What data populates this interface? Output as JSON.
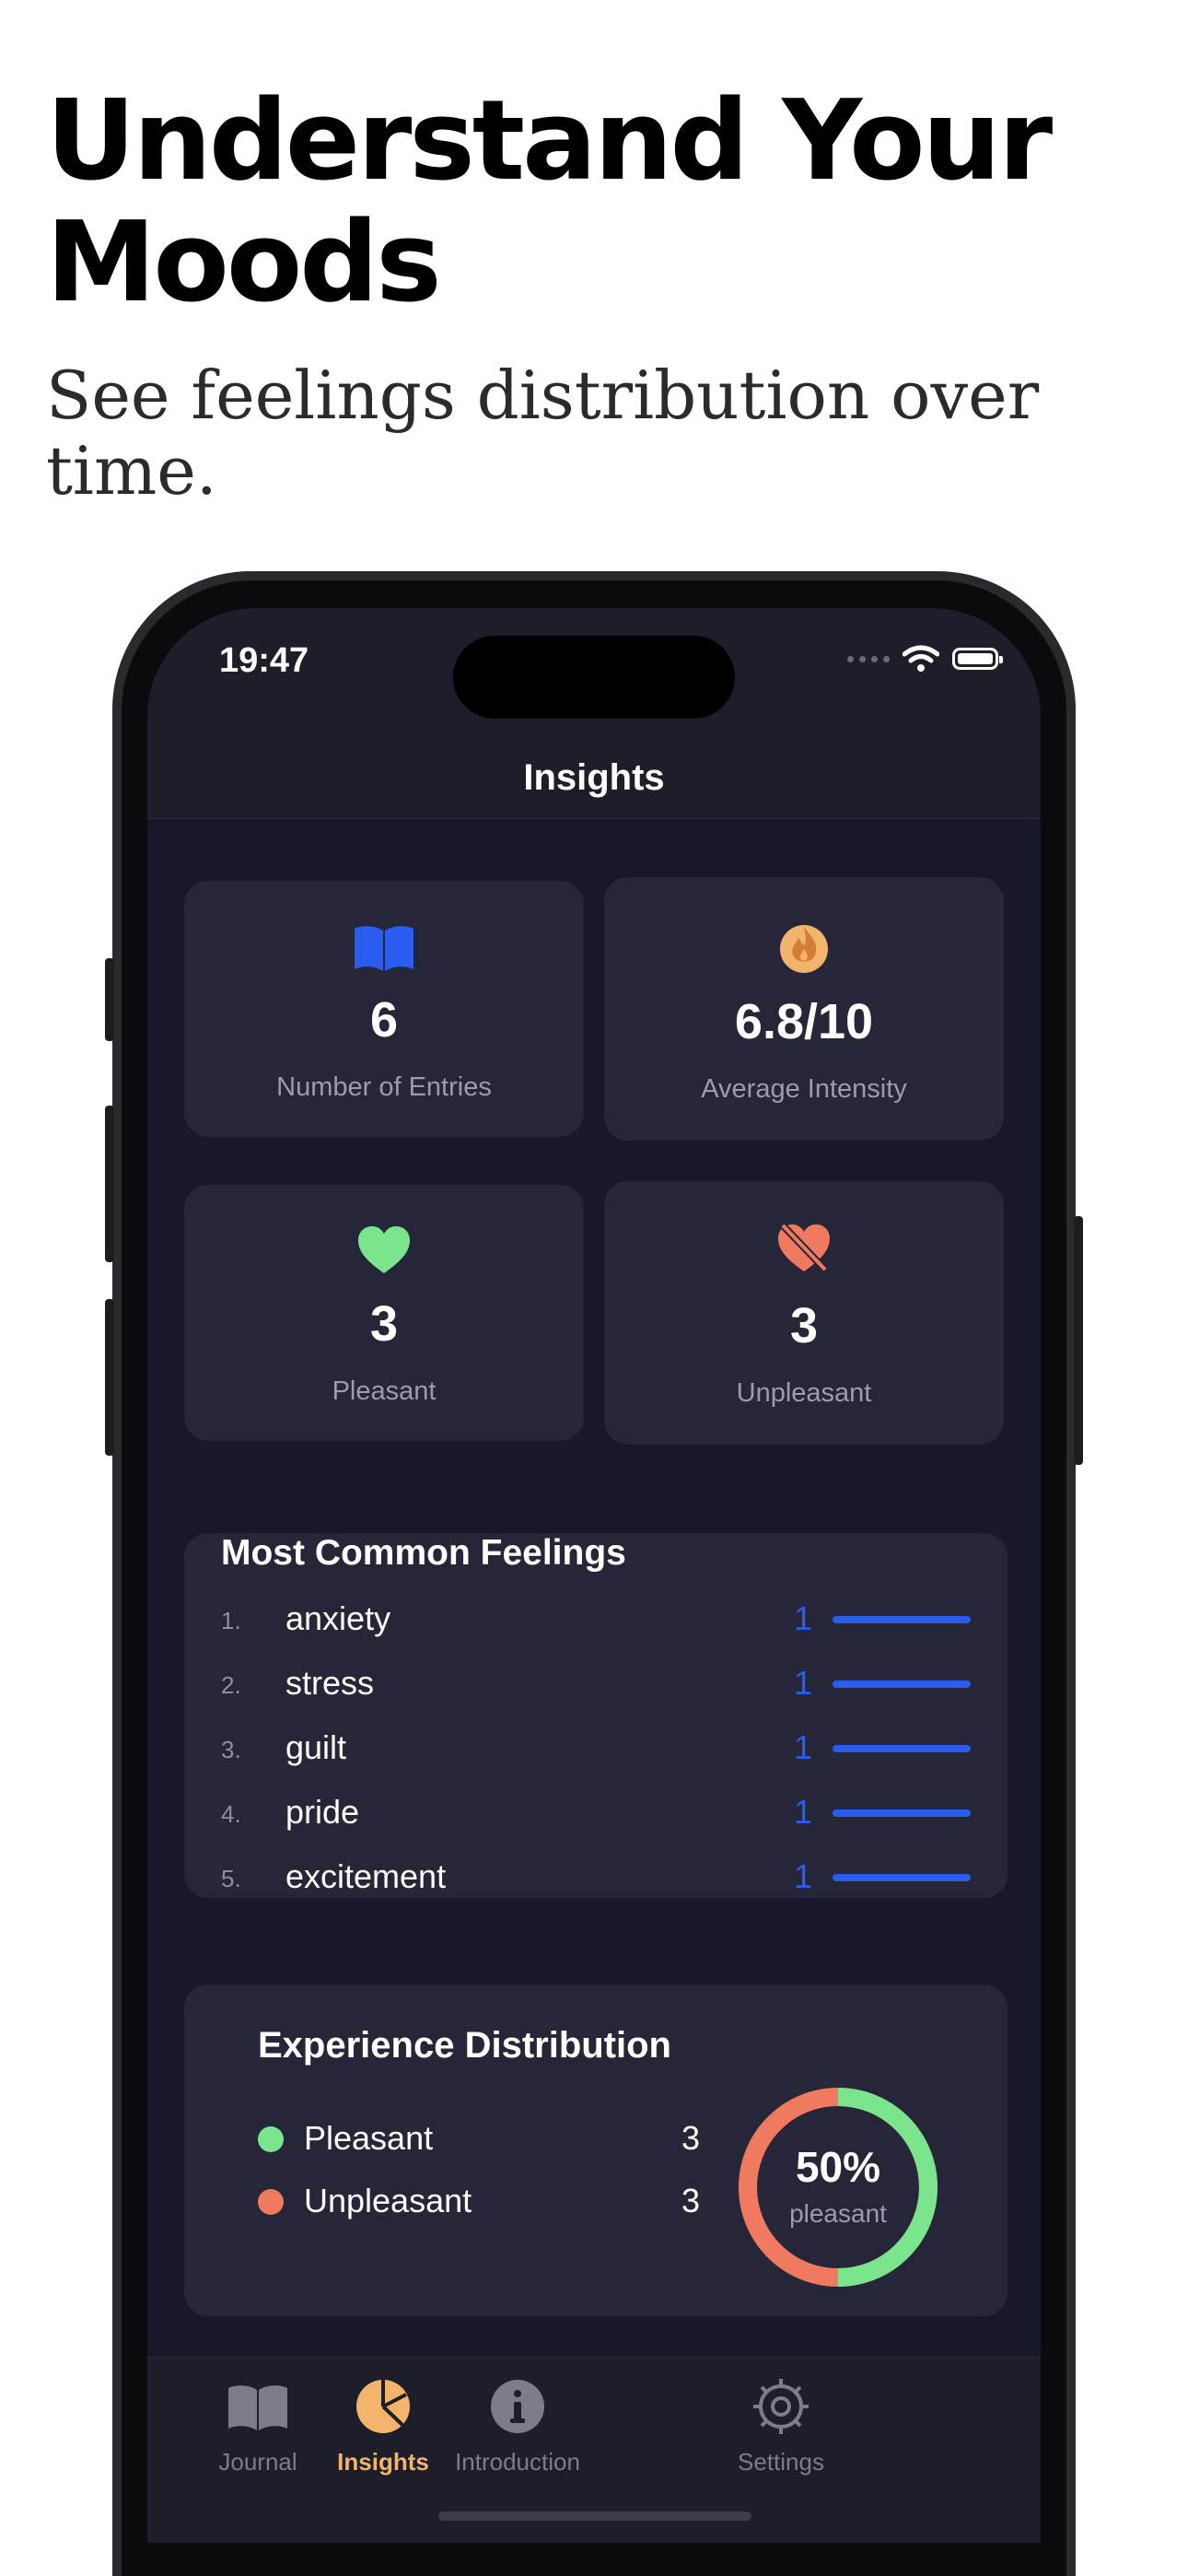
{
  "promo": {
    "headline_line1": "Understand Your",
    "headline_line2": "Moods",
    "subtitle_line1": "See feelings distribution over",
    "subtitle_line2": "time."
  },
  "status_bar": {
    "time": "19:47"
  },
  "nav": {
    "title": "Insights"
  },
  "stats": [
    {
      "icon": "book-icon",
      "value": "6",
      "label": "Number of Entries",
      "color": "#2a5cf0"
    },
    {
      "icon": "flame-icon",
      "value": "6.8/10",
      "label": "Average Intensity",
      "color": "#f2b36a"
    },
    {
      "icon": "heart-icon",
      "value": "3",
      "label": "Pleasant",
      "color": "#7ae58c"
    },
    {
      "icon": "heart-slash-icon",
      "value": "3",
      "label": "Unpleasant",
      "color": "#f07a5f"
    }
  ],
  "common_feelings": {
    "title": "Most Common Feelings",
    "items": [
      {
        "rank": "1.",
        "name": "anxiety",
        "count": "1"
      },
      {
        "rank": "2.",
        "name": "stress",
        "count": "1"
      },
      {
        "rank": "3.",
        "name": "guilt",
        "count": "1"
      },
      {
        "rank": "4.",
        "name": "pride",
        "count": "1"
      },
      {
        "rank": "5.",
        "name": "excitement",
        "count": "1"
      }
    ],
    "bar_color": "#2a5cf0"
  },
  "distribution": {
    "title": "Experience Distribution",
    "legend": [
      {
        "name": "Pleasant",
        "value": "3",
        "color": "#7ae58c"
      },
      {
        "name": "Unpleasant",
        "value": "3",
        "color": "#f07a5f"
      }
    ],
    "donut_percent": "50%",
    "donut_label": "pleasant",
    "pleasant_fraction": 0.5
  },
  "tabs": [
    {
      "icon": "book-icon",
      "label": "Journal",
      "active": false
    },
    {
      "icon": "pie-chart-icon",
      "label": "Insights",
      "active": true
    },
    {
      "icon": "info-icon",
      "label": "Introduction",
      "active": false
    },
    {
      "icon": "gear-icon",
      "label": "Settings",
      "active": false
    }
  ],
  "colors": {
    "accent_tab": "#f2b36a",
    "background": "#171829",
    "card": "#252638"
  }
}
